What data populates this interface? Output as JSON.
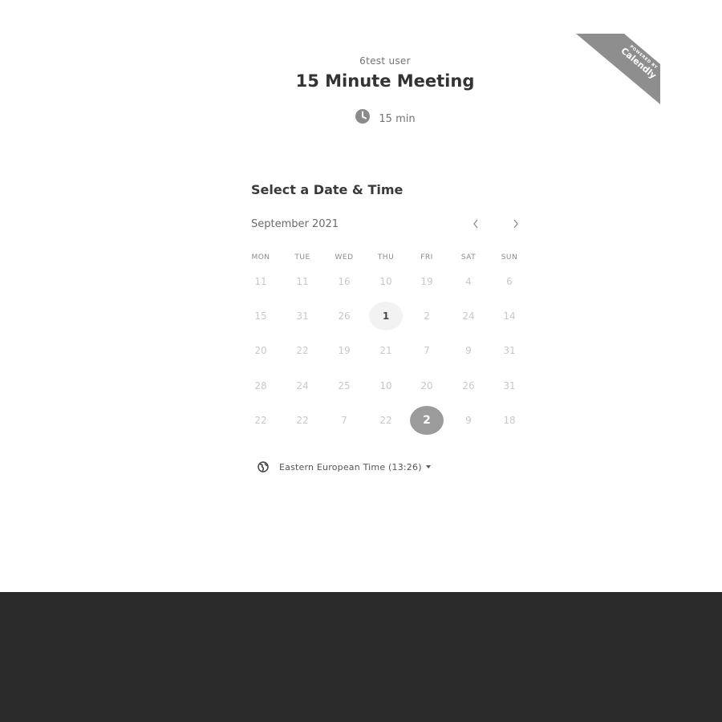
{
  "event": {
    "owner": "6test user",
    "title": "15 Minute Meeting",
    "duration": "15 min"
  },
  "ribbon": {
    "small_text": "POWERED BY",
    "brand": "Calendly"
  },
  "calendar": {
    "section_title": "Select a Date & Time",
    "month": "September 2021",
    "prev_icon": "chevron-left-icon",
    "next_icon": "chevron-right-icon",
    "weekdays": [
      "MON",
      "TUE",
      "WED",
      "THU",
      "FRI",
      "SAT",
      "SUN"
    ],
    "weeks": [
      [
        "11",
        "11",
        "16",
        "10",
        "19",
        "4",
        "6"
      ],
      [
        "15",
        "31",
        "26",
        "1",
        "2",
        "24",
        "14"
      ],
      [
        "20",
        "22",
        "19",
        "21",
        "7",
        "9",
        "31"
      ],
      [
        "28",
        "24",
        "25",
        "10",
        "20",
        "26",
        "31"
      ],
      [
        "22",
        "22",
        "7",
        "22",
        "2",
        "9",
        "18"
      ]
    ],
    "today_day": "1",
    "selected_day": "2"
  },
  "timezone": {
    "label": "Eastern European Time (13:26)",
    "icon": "globe-icon"
  },
  "colors": {
    "footer": "#2b2b2b",
    "selected": "#9b9b9b",
    "ribbon": "#8e8e8e"
  }
}
